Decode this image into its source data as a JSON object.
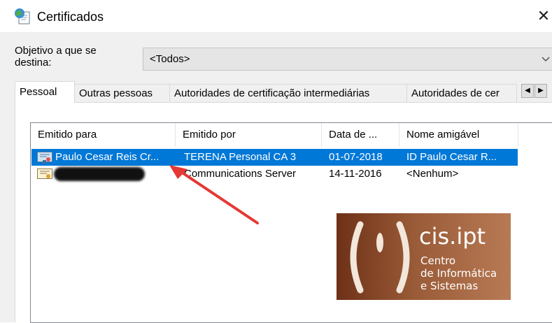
{
  "window": {
    "title": "Certificados",
    "close_label": "✕"
  },
  "purpose": {
    "label": "Objetivo a que se destina:",
    "value": "<Todos>"
  },
  "tabs": [
    {
      "label": "Pessoal",
      "active": true
    },
    {
      "label": "Outras pessoas",
      "active": false
    },
    {
      "label": "Autoridades de certificação intermediárias",
      "active": false
    },
    {
      "label": "Autoridades de cer",
      "active": false
    }
  ],
  "tab_scroll": {
    "left": "◀",
    "right": "▶"
  },
  "list": {
    "columns": [
      "Emitido para",
      "Emitido por",
      "Data de ...",
      "Nome amigável"
    ],
    "rows": [
      {
        "issued_to": "Paulo Cesar Reis Cr...",
        "issued_by": "TERENA Personal CA 3",
        "date": "01-07-2018",
        "friendly_name": "ID Paulo Cesar R...",
        "selected": true
      },
      {
        "issued_to": "",
        "issued_by": "Communications Server",
        "date": "14-11-2016",
        "friendly_name": "<Nenhum>",
        "selected": false
      }
    ]
  },
  "logo": {
    "brand": "cis.ipt",
    "lines": [
      "Centro",
      "de Informática",
      "e Sistemas"
    ]
  },
  "colors": {
    "selection": "#0078d7",
    "arrow": "#e53935",
    "logo": "#8a4a2a"
  }
}
